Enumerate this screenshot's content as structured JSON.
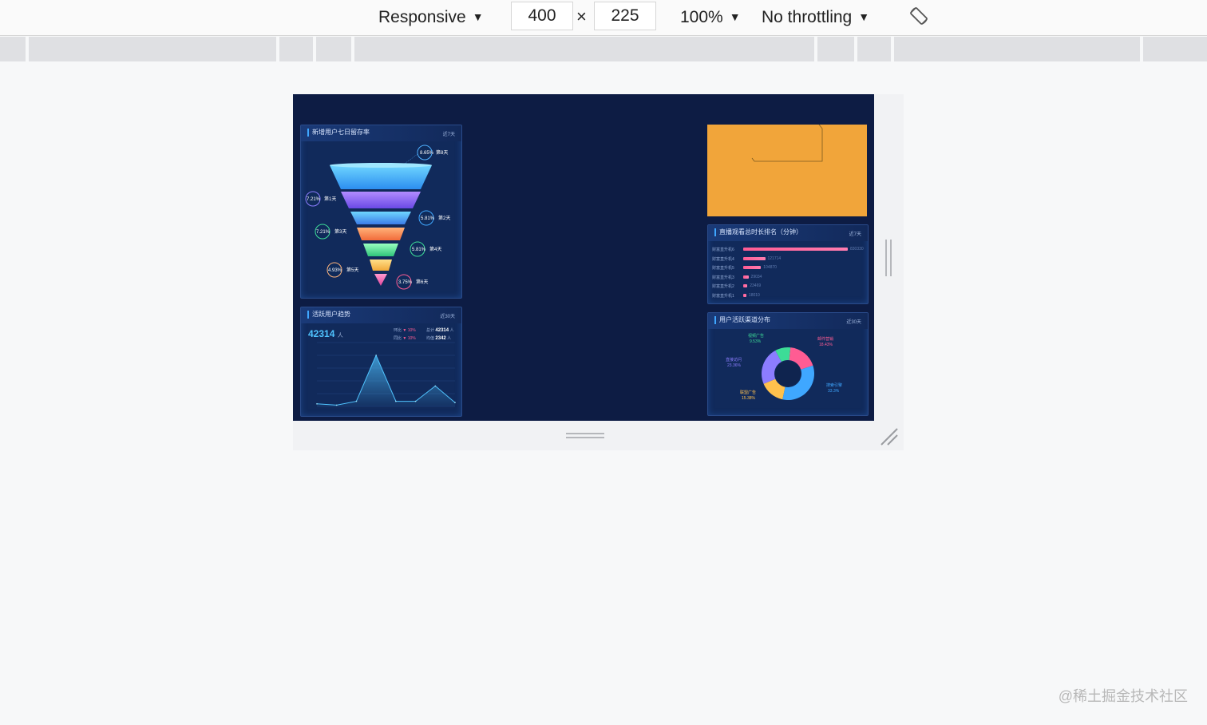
{
  "toolbar": {
    "device": "Responsive",
    "width": "400",
    "times": "×",
    "height": "225",
    "zoom": "100%",
    "throttling": "No throttling"
  },
  "panels": {
    "funnel": {
      "title": "新增用户七日留存率",
      "tag": "近7天",
      "labels": [
        {
          "pct": "8.65%",
          "day": "第8天"
        },
        {
          "pct": "7.21%",
          "day": "第1天"
        },
        {
          "pct": "5.81%",
          "day": "第2天"
        },
        {
          "pct": "7.21%",
          "day": "第3天"
        },
        {
          "pct": "5.81%",
          "day": "第4天"
        },
        {
          "pct": "4.93%",
          "day": "第5天"
        },
        {
          "pct": "3.75%",
          "day": "第6天"
        }
      ]
    },
    "trend": {
      "title": "活跃用户趋势",
      "tag": "近30天",
      "total": "42314",
      "unit": "人",
      "stat1_label": "环比",
      "stat1_value": "10%",
      "stat2_label": "同比",
      "stat2_value": "10%",
      "sum_label": "总计",
      "sum_value": "42314",
      "sum_unit": "人",
      "avg_label": "均值",
      "avg_value": "2342",
      "avg_unit": "人"
    },
    "ranking": {
      "title": "直播观看总时长排名（分钟）",
      "tag": "近7天",
      "rows": [
        {
          "name": "财富直升机6",
          "value": "830330",
          "ratio": 1.0
        },
        {
          "name": "财富直升机4",
          "value": "121714",
          "ratio": 0.21
        },
        {
          "name": "财富直升机5",
          "value": "104870",
          "ratio": 0.17
        },
        {
          "name": "财富直升机3",
          "value": "29034",
          "ratio": 0.05
        },
        {
          "name": "财富直升机2",
          "value": "23469",
          "ratio": 0.04
        },
        {
          "name": "财富直升机1",
          "value": "18010",
          "ratio": 0.03
        }
      ]
    },
    "channels": {
      "title": "用户活跃渠道分布",
      "tag": "近30天",
      "slices": [
        {
          "name": "视频广告",
          "pct": "9.53%",
          "value": 9.53,
          "color": "#3ddc97"
        },
        {
          "name": "邮件营销",
          "pct": "18.43%",
          "value": 18.43,
          "color": "#ff5c93"
        },
        {
          "name": "搜索引擎",
          "pct": "33.3%",
          "value": 33.3,
          "color": "#3fa7ff"
        },
        {
          "name": "联盟广告",
          "pct": "15.38%",
          "value": 15.38,
          "color": "#ffc14d"
        },
        {
          "name": "直接访问",
          "pct": "23.36%",
          "value": 23.36,
          "color": "#8c7dff"
        }
      ]
    }
  },
  "chart_data": {
    "type": "line",
    "values": [
      2,
      1,
      4,
      40,
      4,
      4,
      16,
      3
    ],
    "ylim": [
      0,
      50
    ]
  },
  "colors": {
    "background": "#0d1c44",
    "panel": "#112a5b",
    "accent": "#3fa7ff",
    "orange": "#f1a53a"
  },
  "watermark": "@稀土掘金技术社区"
}
